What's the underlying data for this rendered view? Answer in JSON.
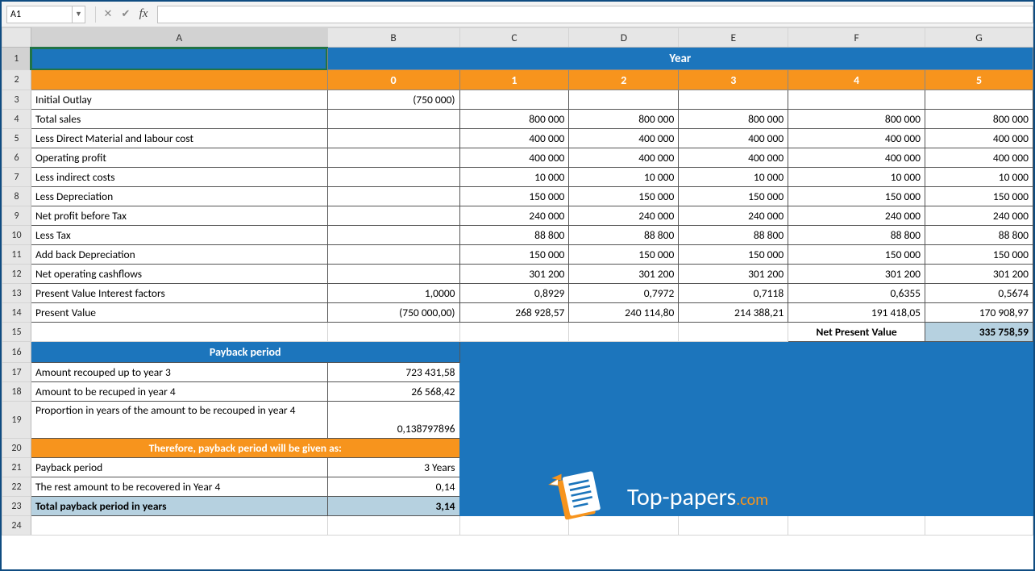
{
  "namebox": "A1",
  "formula": "",
  "cols": [
    "A",
    "B",
    "C",
    "D",
    "E",
    "F",
    "G"
  ],
  "rows": [
    "1",
    "2",
    "3",
    "4",
    "5",
    "6",
    "7",
    "8",
    "9",
    "10",
    "11",
    "12",
    "13",
    "14",
    "15",
    "16",
    "17",
    "18",
    "19",
    "20",
    "21",
    "22",
    "23",
    "24"
  ],
  "r1": {
    "year": "Year"
  },
  "r2": {
    "y0": "0",
    "y1": "1",
    "y2": "2",
    "y3": "3",
    "y4": "4",
    "y5": "5"
  },
  "labels": {
    "r3": "Initial Outlay",
    "r4": "Total sales",
    "r5": "Less Direct Material and labour cost",
    "r6": "Operating profit",
    "r7": "Less indirect costs",
    "r8": "Less Depreciation",
    "r9": "Net profit before Tax",
    "r10": "Less Tax",
    "r11": "Add back Depreciation",
    "r12": "Net operating cashflows",
    "r13": "Present Value Interest factors",
    "r14": "Present Value",
    "r15_npv": "Net Present Value",
    "r16": "Payback period",
    "r17": "Amount recouped up to year 3",
    "r18": "Amount to be recuped in year 4",
    "r19": "Proportion in years of the amount to be recouped in year 4",
    "r20": "Therefore, payback period will be given as:",
    "r21": "Payback period",
    "r22": "The rest amount to be recovered in Year 4",
    "r23": "Total payback period in years"
  },
  "vals": {
    "r3b": "(750 000)",
    "r4": [
      "800 000",
      "800 000",
      "800 000",
      "800 000",
      "800 000"
    ],
    "r5": [
      "400 000",
      "400 000",
      "400 000",
      "400 000",
      "400 000"
    ],
    "r6": [
      "400 000",
      "400 000",
      "400 000",
      "400 000",
      "400 000"
    ],
    "r7": [
      "10 000",
      "10 000",
      "10 000",
      "10 000",
      "10 000"
    ],
    "r8": [
      "150 000",
      "150 000",
      "150 000",
      "150 000",
      "150 000"
    ],
    "r9": [
      "240 000",
      "240 000",
      "240 000",
      "240 000",
      "240 000"
    ],
    "r10": [
      "88 800",
      "88 800",
      "88 800",
      "88 800",
      "88 800"
    ],
    "r11": [
      "150 000",
      "150 000",
      "150 000",
      "150 000",
      "150 000"
    ],
    "r12": [
      "301 200",
      "301 200",
      "301 200",
      "301 200",
      "301 200"
    ],
    "r13b": "1,0000",
    "r13": [
      "0,8929",
      "0,7972",
      "0,7118",
      "0,6355",
      "0,5674"
    ],
    "r14b": "(750 000,00)",
    "r14": [
      "268 928,57",
      "240 114,80",
      "214 388,21",
      "191 418,05",
      "170 908,97"
    ],
    "r15_npv": "335 758,59",
    "r17": "723 431,58",
    "r18": "26 568,42",
    "r19": "0,138797896",
    "r21": "3 Years",
    "r22": "0,14",
    "r23": "3,14"
  },
  "watermark": {
    "brand": "Top-papers",
    "tld": ".com"
  }
}
